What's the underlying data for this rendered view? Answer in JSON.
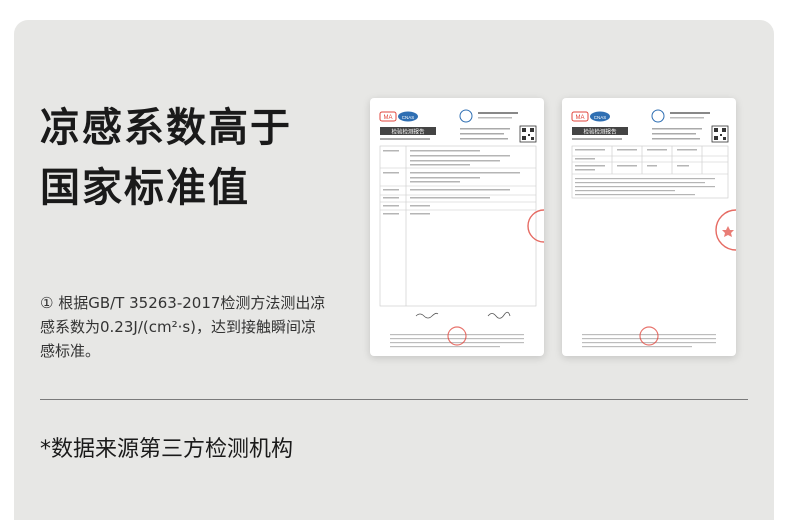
{
  "headline": {
    "line1": "凉感系数高于",
    "line2": "国家标准值"
  },
  "description": "① 根据GB/T 35263-2017检测方法测出凉感系数为0.23J/(cm²·s)，达到接触瞬间凉感标准。",
  "source_note": "*数据来源第三方检测机构",
  "reports": [
    {
      "title": "检验检测报告",
      "badge_ma": "MA",
      "badge_cnas": "CNAS"
    },
    {
      "title": "检验检测报告",
      "badge_ma": "MA",
      "badge_cnas": "CNAS"
    }
  ],
  "colors": {
    "card_bg": "#e7e7e5",
    "headline": "#1a1a1a",
    "stamp_red": "#e0463c",
    "cnas_blue": "#2f6fb3"
  }
}
